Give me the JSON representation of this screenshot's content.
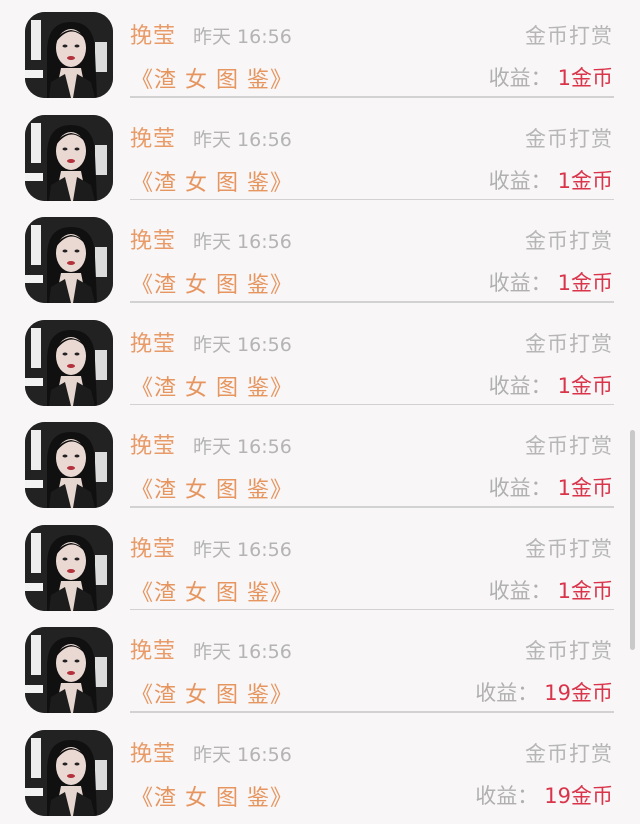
{
  "rows": [
    {
      "user_name": "挽莹",
      "time": "昨天 16:56",
      "type": "金币打赏",
      "work_title": "《渣 女 图 鉴》",
      "income_label": "收益：",
      "income_value": "1金币"
    },
    {
      "user_name": "挽莹",
      "time": "昨天 16:56",
      "type": "金币打赏",
      "work_title": "《渣 女 图 鉴》",
      "income_label": "收益：",
      "income_value": "1金币"
    },
    {
      "user_name": "挽莹",
      "time": "昨天 16:56",
      "type": "金币打赏",
      "work_title": "《渣 女 图 鉴》",
      "income_label": "收益：",
      "income_value": "1金币"
    },
    {
      "user_name": "挽莹",
      "time": "昨天 16:56",
      "type": "金币打赏",
      "work_title": "《渣 女 图 鉴》",
      "income_label": "收益：",
      "income_value": "1金币"
    },
    {
      "user_name": "挽莹",
      "time": "昨天 16:56",
      "type": "金币打赏",
      "work_title": "《渣 女 图 鉴》",
      "income_label": "收益：",
      "income_value": "1金币"
    },
    {
      "user_name": "挽莹",
      "time": "昨天 16:56",
      "type": "金币打赏",
      "work_title": "《渣 女 图 鉴》",
      "income_label": "收益：",
      "income_value": "1金币"
    },
    {
      "user_name": "挽莹",
      "time": "昨天 16:56",
      "type": "金币打赏",
      "work_title": "《渣 女 图 鉴》",
      "income_label": "收益：",
      "income_value": "19金币"
    },
    {
      "user_name": "挽莹",
      "time": "昨天 16:56",
      "type": "金币打赏",
      "work_title": "《渣 女 图 鉴》",
      "income_label": "收益：",
      "income_value": "19金币"
    }
  ],
  "colors": {
    "name": "#e89a67",
    "work_title": "#e6955f",
    "income_value": "#d9344a",
    "muted": "#b4b4b4"
  },
  "icons": {
    "avatar": "user-avatar-photo"
  }
}
